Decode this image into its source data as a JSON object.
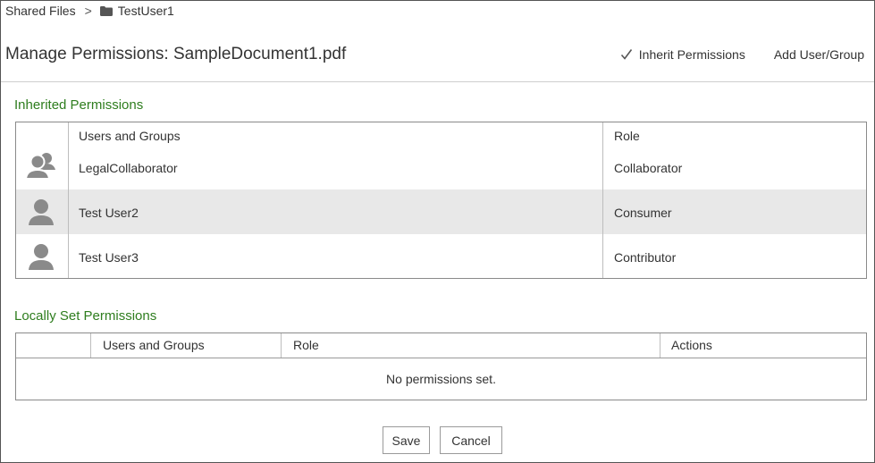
{
  "breadcrumb": {
    "root": "Shared Files",
    "separator": ">",
    "current": "TestUser1",
    "current_icon": "folder-icon"
  },
  "header": {
    "title": "Manage Permissions: SampleDocument1.pdf",
    "inherit_label": "Inherit Permissions",
    "inherit_icon": "check-icon",
    "add_label": "Add User/Group"
  },
  "inherited": {
    "title": "Inherited Permissions",
    "col_users": "Users and Groups",
    "col_role": "Role",
    "rows": [
      {
        "icon": "group-icon",
        "name": "LegalCollaborator",
        "role": "Collaborator"
      },
      {
        "icon": "user-icon",
        "name": "Test User2",
        "role": "Consumer"
      },
      {
        "icon": "user-icon",
        "name": "Test User3",
        "role": "Contributor"
      }
    ]
  },
  "local": {
    "title": "Locally Set Permissions",
    "col_users": "Users and Groups",
    "col_role": "Role",
    "col_actions": "Actions",
    "empty": "No permissions set."
  },
  "footer": {
    "save_label": "Save",
    "cancel_label": "Cancel"
  },
  "colors": {
    "section_title": "#2e7d1e",
    "row_shade": "#e8e8e8",
    "icon": "#8a8a8a"
  }
}
